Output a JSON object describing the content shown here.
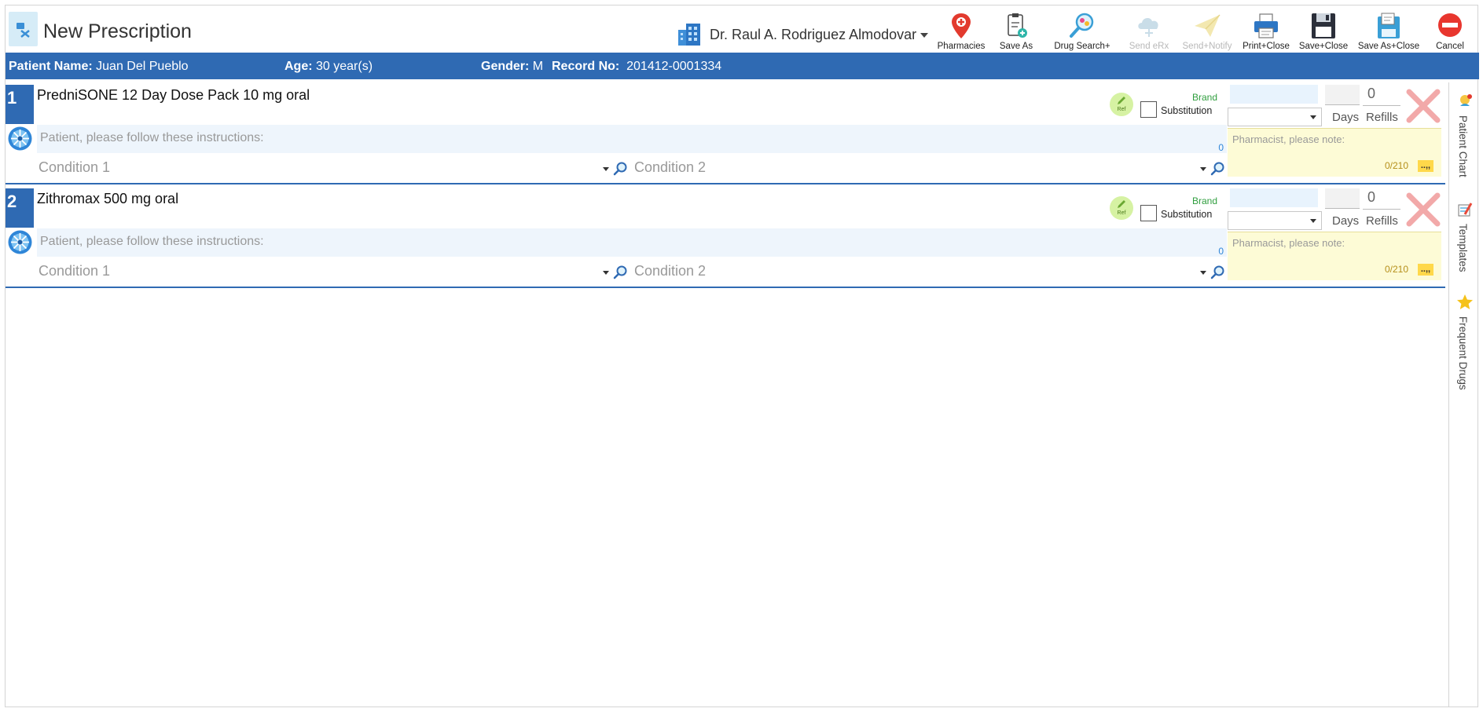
{
  "app": {
    "title": "New Prescription"
  },
  "doctor": {
    "name": "Dr. Raul A. Rodriguez Almodovar"
  },
  "toolbar": {
    "pharmacies": "Pharmacies",
    "save_as": "Save As",
    "drug_search": "Drug Search+",
    "send_erx": "Send eRx",
    "send_notify": "Send+Notify",
    "print_close": "Print+Close",
    "save_close": "Save+Close",
    "save_as_close": "Save As+Close",
    "cancel": "Cancel"
  },
  "patient": {
    "name_label": "Patient Name:",
    "name": "Juan Del Pueblo",
    "age_label": "Age:",
    "age": "30 year(s)",
    "gender_label": "Gender:",
    "gender": "M",
    "record_label": "Record No:",
    "record": "201412-0001334"
  },
  "prescriptions": [
    {
      "number": "1",
      "drug": "PredniSONE 12 Day Dose Pack 10 mg oral",
      "instructions_placeholder": "Patient, please follow these instructions:",
      "instructions_count": "0",
      "condition1_placeholder": "Condition 1",
      "condition2_placeholder": "Condition 2",
      "ref_label": "Ref",
      "brand_label": "Brand",
      "substitution_label": "Substitution",
      "refills_value": "0",
      "days_label": "Days",
      "refills_label": "Refills",
      "pharmacist_placeholder": "Pharmacist, please note:",
      "pharmacist_count": "0/210",
      "quote_label": "..,,"
    },
    {
      "number": "2",
      "drug": "Zithromax 500 mg oral",
      "instructions_placeholder": "Patient, please follow these instructions:",
      "instructions_count": "0",
      "condition1_placeholder": "Condition 1",
      "condition2_placeholder": "Condition 2",
      "ref_label": "Ref",
      "brand_label": "Brand",
      "substitution_label": "Substitution",
      "refills_value": "0",
      "days_label": "Days",
      "refills_label": "Refills",
      "pharmacist_placeholder": "Pharmacist, please note:",
      "pharmacist_count": "0/210",
      "quote_label": "..,,"
    }
  ],
  "side_panel": {
    "patient_chart": "Patient Chart",
    "templates": "Templates",
    "frequent_drugs": "Frequent Drugs"
  },
  "colors": {
    "accent": "#2f6ab3",
    "brand_green": "#2f9e3e",
    "note_bg": "#fdfbd6",
    "delete_red": "#f2a9a9"
  }
}
